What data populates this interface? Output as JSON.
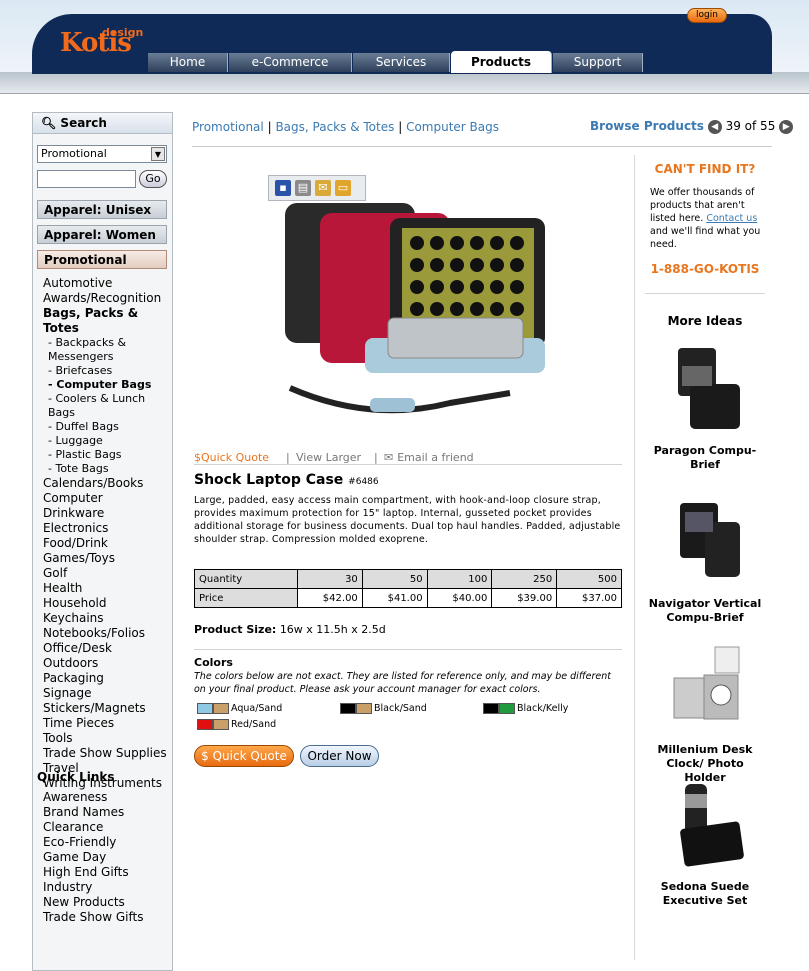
{
  "header": {
    "logo_main": "Kotis",
    "logo_sub": "design",
    "login": "login",
    "tabs": [
      "Home",
      "e-Commerce",
      "Services",
      "Products",
      "Support"
    ]
  },
  "sidebar": {
    "search_title": "Search",
    "select_value": "Promotional",
    "go": "Go",
    "cat_heads": [
      "Apparel: Unisex",
      "Apparel: Women",
      "Promotional"
    ],
    "items": [
      "Automotive",
      "Awards/Recognition",
      "Bags, Packs & Totes",
      "- Backpacks &",
      "Messengers",
      "- Briefcases",
      "- Computer Bags",
      "- Coolers & Lunch Bags",
      "- Duffel Bags",
      "- Luggage",
      "- Plastic Bags",
      "- Tote Bags",
      "Calendars/Books",
      "Computer",
      "Drinkware",
      "Electronics",
      "Food/Drink",
      "Games/Toys",
      "Golf",
      "Health",
      "Household",
      "Keychains",
      "Notebooks/Folios",
      "Office/Desk",
      "Outdoors",
      "Packaging",
      "Signage",
      "Stickers/Magnets",
      "Time Pieces",
      "Tools",
      "Trade Show Supplies",
      "Travel",
      "Writing Instruments"
    ],
    "quick_links_title": "Quick Links",
    "quick_links": [
      "Awareness",
      "Brand Names",
      "Clearance",
      "Eco-Friendly",
      "Game Day",
      "High End Gifts",
      "Industry",
      "New Products",
      "Trade Show Gifts"
    ]
  },
  "breadcrumb": {
    "a": "Promotional",
    "b": "Bags, Packs & Totes",
    "c": "Computer Bags",
    "sep": "|"
  },
  "browse": {
    "label": "Browse Products",
    "count": "39 of 55"
  },
  "actions": {
    "quote": "$Quick Quote",
    "larger": "View Larger",
    "email": "Email a friend"
  },
  "product": {
    "title": "Shock Laptop Case",
    "sku": "#6486",
    "description": "Large, padded, easy access main compartment, with hook-and-loop closure strap, provides maximum protection for 15\" laptop. Internal, gusseted pocket provides additional storage for business documents. Dual top haul handles. Padded, adjustable shoulder strap. Compression molded exoprene.",
    "size_label": "Product Size:",
    "size_value": "16w x 11.5h x 2.5d"
  },
  "pricing": {
    "row1_label": "Quantity",
    "quantities": [
      "30",
      "50",
      "100",
      "250",
      "500"
    ],
    "row2_label": "Price",
    "prices": [
      "$42.00",
      "$41.00",
      "$40.00",
      "$39.00",
      "$37.00"
    ]
  },
  "colors": {
    "title": "Colors",
    "note": "The colors below are not exact. They are listed for reference only, and may be different on your final product. Please ask your account manager for exact colors.",
    "swatches": [
      {
        "name": "Aqua/Sand",
        "c1": "#8fc9e6",
        "c2": "#c9a06a"
      },
      {
        "name": "Black/Sand",
        "c1": "#000000",
        "c2": "#c9a06a"
      },
      {
        "name": "Black/Kelly",
        "c1": "#000000",
        "c2": "#1f9a3e"
      },
      {
        "name": "Red/Sand",
        "c1": "#e01010",
        "c2": "#c9a06a"
      }
    ]
  },
  "buttons": {
    "quote": "$ Quick Quote",
    "order": "Order Now"
  },
  "right": {
    "cant_find": "CAN'T FIND IT?",
    "text_before": "We offer thousands of products that aren't listed here.",
    "contact": "Contact us",
    "text_after": "and we'll find what you need.",
    "phone": "1-888-GO-KOTIS",
    "more_ideas": "More Ideas",
    "ideas": [
      "Paragon Compu-Brief",
      "Navigator Vertical Compu-Brief",
      "Millenium Desk Clock/ Photo Holder",
      "Sedona Suede Executive Set"
    ]
  },
  "colors_ui": {
    "accent": "#e8761f",
    "link": "#3b7ab3",
    "navy": "#0f2a56"
  }
}
